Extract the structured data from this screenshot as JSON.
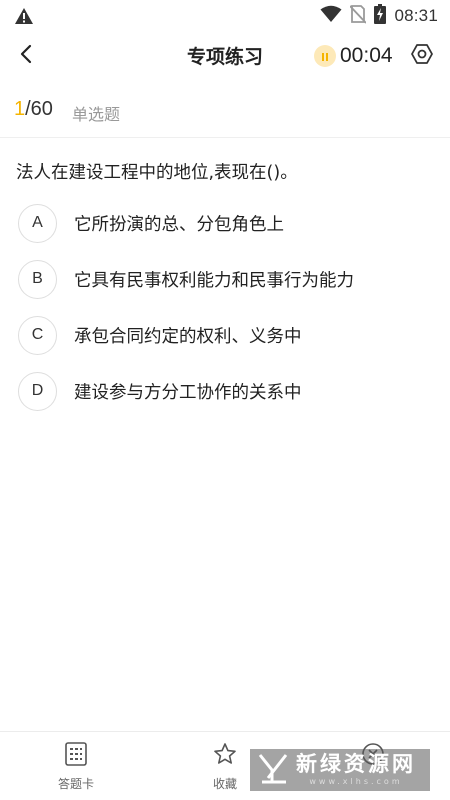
{
  "status_bar": {
    "time": "08:31",
    "icons": [
      "warning-icon",
      "wifi-icon",
      "no-sim-icon",
      "battery-charging-icon"
    ]
  },
  "header": {
    "title": "专项练习",
    "timer": "00:04",
    "icons": [
      "back-arrow-icon",
      "pause-icon",
      "settings-icon"
    ]
  },
  "progress": {
    "current": "1",
    "total": "/60",
    "question_type": "单选题"
  },
  "question": {
    "text": "法人在建设工程中的地位,表现在()。",
    "options": [
      {
        "letter": "A",
        "text": "它所扮演的总、分包角色上"
      },
      {
        "letter": "B",
        "text": "它具有民事权利能力和民事行为能力"
      },
      {
        "letter": "C",
        "text": "承包合同约定的权利、义务中"
      },
      {
        "letter": "D",
        "text": "建设参与方分工协作的关系中"
      }
    ]
  },
  "bottom_bar": {
    "answer_card": "答题卡",
    "favorite": "收藏",
    "icons": [
      "answer-card-icon",
      "star-icon",
      "error-icon"
    ]
  },
  "watermark": {
    "text": "新绿资源网",
    "url": "www.xlhs.com"
  },
  "colors": {
    "accent": "#f5b400",
    "pause_bg": "#fde9b8",
    "muted_text": "#999999"
  }
}
